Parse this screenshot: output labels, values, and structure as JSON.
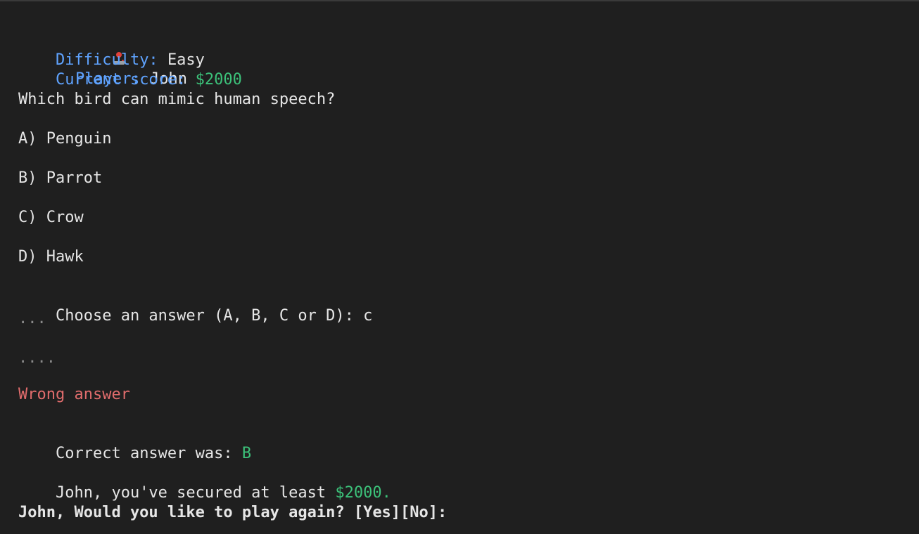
{
  "header": {
    "player_label": "Player:",
    "player_value": "John",
    "difficulty_label": "Difficulty:",
    "difficulty_value": "Easy",
    "score_label": "Current score:",
    "score_value": "$2000",
    "player_icon": "joystick-icon"
  },
  "question": {
    "text": "Which bird can mimic human speech?",
    "options": [
      "A) Penguin",
      "B) Parrot",
      "C) Crow",
      "D) Hawk"
    ]
  },
  "prompt": {
    "text": "Choose an answer (A, B, C or D):",
    "input_value": "c"
  },
  "progress": {
    "dots1": "...",
    "dots2": "...."
  },
  "result": {
    "wrong_text": "Wrong answer",
    "correct_label": "Correct answer was:",
    "correct_value": "B",
    "secured_prefix": "John, you've secured at least",
    "secured_amount": "$2000.",
    "play_again": "John, Would you like to play again? [Yes][No]:"
  },
  "colors": {
    "background": "#1f1f1f",
    "label_blue": "#5fa3ff",
    "money_green": "#3cc27a",
    "error_red": "#e06c6c",
    "text": "#e6e6e6"
  }
}
